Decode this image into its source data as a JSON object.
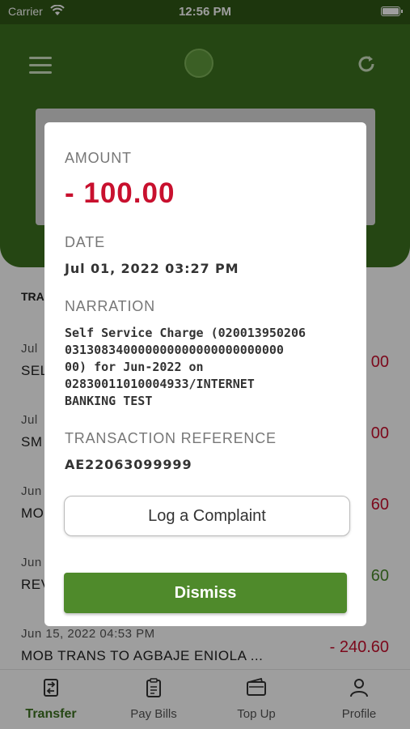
{
  "status_bar": {
    "carrier": "Carrier",
    "time": "12:56 PM"
  },
  "list": {
    "section_title": "TRA",
    "transactions": [
      {
        "date": "Jul",
        "desc": "SEL",
        "amount": "00",
        "sign": "neg"
      },
      {
        "date": "Jul",
        "desc": "SM",
        "amount": "00",
        "sign": "neg"
      },
      {
        "date": "Jun",
        "desc": "MO",
        "amount": "60",
        "sign": "neg"
      },
      {
        "date": "Jun",
        "desc": "REV",
        "amount": "60",
        "sign": "pos"
      },
      {
        "date": "Jun 15, 2022 04:53 PM",
        "desc": "MOB TRANS TO AGBAJE ENIOLA ...",
        "amount": "- 240.60",
        "sign": "neg"
      }
    ]
  },
  "tabs": [
    {
      "label": "Transfer",
      "icon": "transfer-icon",
      "active": true
    },
    {
      "label": "Pay Bills",
      "icon": "clipboard-icon",
      "active": false
    },
    {
      "label": "Top Up",
      "icon": "wallet-icon",
      "active": false
    },
    {
      "label": "Profile",
      "icon": "person-icon",
      "active": false
    }
  ],
  "modal": {
    "amount_label": "AMOUNT",
    "amount": "- 100.00",
    "date_label": "DATE",
    "date": "Jul 01, 2022 03:27 PM",
    "narration_label": "NARRATION",
    "narration": "Self Service Charge (020013950206\n031308340000000000000000000000\n00) for Jun-2022 on\n02830011010004933/INTERNET\nBANKING TEST",
    "reference_label": "TRANSACTION REFERENCE",
    "reference": "AE22063099999",
    "complaint_button": "Log a Complaint",
    "dismiss_button": "Dismiss"
  },
  "colors": {
    "header_green": "#3d7220",
    "negative": "#c8102e",
    "positive": "#4a8a2a",
    "dismiss_green": "#4f8a2b"
  }
}
